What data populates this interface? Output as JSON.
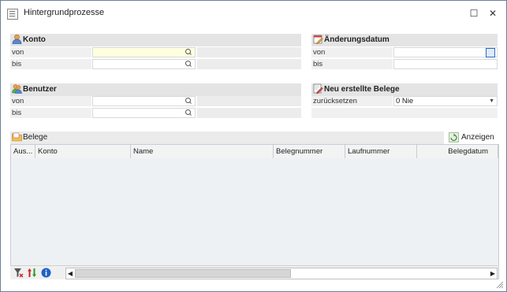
{
  "window": {
    "title": "Hintergrundprozesse",
    "maximize_glyph": "☐",
    "close_glyph": "✕"
  },
  "konto": {
    "title": "Konto",
    "von_label": "von",
    "bis_label": "bis",
    "von_value": "",
    "bis_value": ""
  },
  "benutzer": {
    "title": "Benutzer",
    "von_label": "von",
    "bis_label": "bis",
    "von_value": "",
    "bis_value": ""
  },
  "aenderungsdatum": {
    "title": "Änderungsdatum",
    "von_label": "von",
    "bis_label": "bis",
    "von_value": "",
    "bis_value": ""
  },
  "neu_belege": {
    "title": "Neu erstellte Belege",
    "reset_label": "zurücksetzen",
    "reset_value": "0 Nie"
  },
  "belege": {
    "title": "Belege",
    "anzeigen_label": "Anzeigen",
    "columns": [
      "Aus...",
      "Konto",
      "Name",
      "Belegnummer",
      "Laufnummer",
      "Belegdatum"
    ],
    "rows": []
  },
  "colors": {
    "accent_blue": "#2b6cc4",
    "input_highlight": "#ffffe0",
    "section_bar": "#e4e4e4"
  },
  "icons": [
    "app-icon",
    "user-icon",
    "users-icon",
    "calendar-edit-icon",
    "document-new-icon",
    "folder-icon",
    "refresh-icon",
    "filter-icon",
    "sort-icon",
    "info-icon"
  ]
}
